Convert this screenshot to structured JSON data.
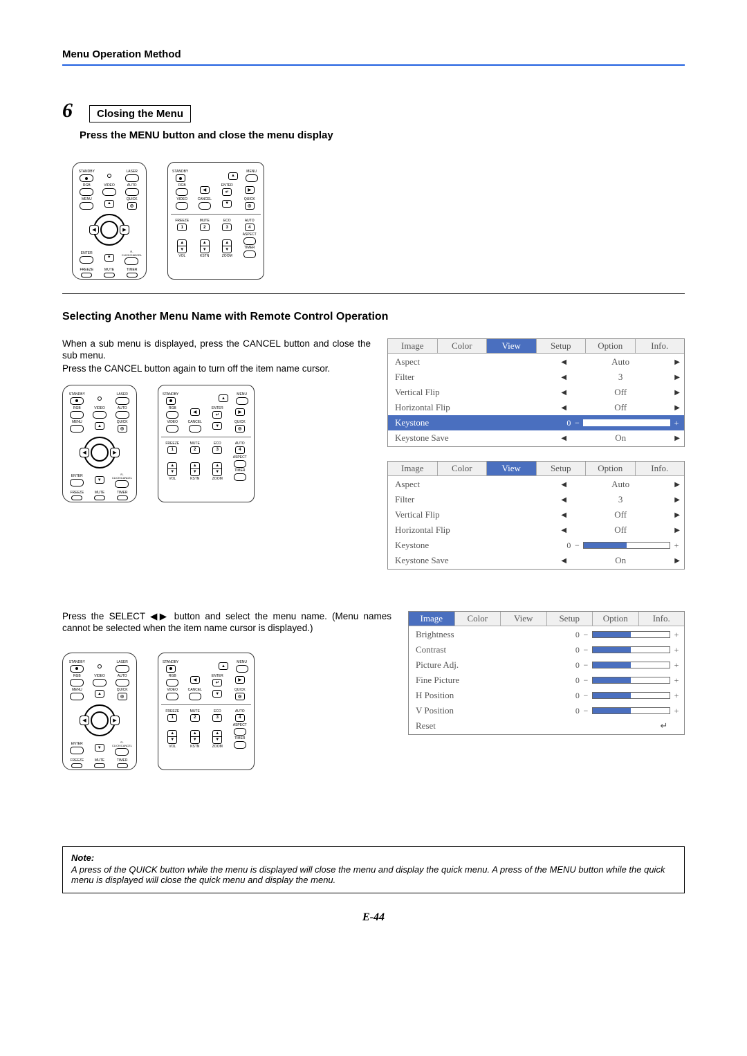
{
  "header": {
    "title": "Menu Operation Method"
  },
  "step6": {
    "number": "6",
    "box_title": "Closing the Menu",
    "instruction": "Press the MENU button and close the menu display"
  },
  "section2": {
    "heading": "Selecting Another Menu Name with Remote Control Operation",
    "para1a": "When a sub menu is displayed, press the CANCEL button and close the sub menu.",
    "para1b": "Press the CANCEL button again to turn off the item name cursor.",
    "para2": "Press the SELECT ◀▶ button and select the menu name. (Menu names cannot be selected when the item name cursor is displayed.)"
  },
  "remote_small": {
    "labels": [
      "STANDBY",
      "LASER",
      "RGB",
      "VIDEO",
      "AUTO",
      "MENU",
      "QUICK",
      "ENTER",
      "R-CLICK/CANCEL",
      "FREEZE",
      "MUTE",
      "TIMER"
    ]
  },
  "remote_card": {
    "labels_top": [
      "STANDBY",
      "MENU",
      "RGB",
      "ENTER",
      "VIDEO",
      "CANCEL",
      "QUICK"
    ],
    "labels_mid": [
      "FREEZE",
      "MUTE",
      "ECO",
      "AUTO",
      "ASPECT"
    ],
    "labels_bot": [
      "VOL",
      "KSTN",
      "ZOOM",
      "TIMER"
    ],
    "nums": [
      "1",
      "2",
      "3",
      "4"
    ]
  },
  "osd_tabs": [
    "Image",
    "Color",
    "View",
    "Setup",
    "Option",
    "Info."
  ],
  "osd_view": {
    "active_tab": "View",
    "items": [
      {
        "label": "Aspect",
        "type": "choice",
        "value": "Auto"
      },
      {
        "label": "Filter",
        "type": "choice",
        "value": "3"
      },
      {
        "label": "Vertical Flip",
        "type": "choice",
        "value": "Off"
      },
      {
        "label": "Horizontal Flip",
        "type": "choice",
        "value": "Off"
      },
      {
        "label": "Keystone",
        "type": "slider",
        "value": "0"
      },
      {
        "label": "Keystone Save",
        "type": "choice",
        "value": "On"
      }
    ],
    "highlight_a": "Keystone",
    "highlight_b": null
  },
  "osd_image": {
    "active_tab": "Image",
    "items": [
      {
        "label": "Brightness",
        "type": "slider",
        "value": "0"
      },
      {
        "label": "Contrast",
        "type": "slider",
        "value": "0"
      },
      {
        "label": "Picture Adj.",
        "type": "slider",
        "value": "0"
      },
      {
        "label": "Fine Picture",
        "type": "slider",
        "value": "0"
      },
      {
        "label": "H Position",
        "type": "slider",
        "value": "0"
      },
      {
        "label": "V Position",
        "type": "slider",
        "value": "0"
      },
      {
        "label": "Reset",
        "type": "enter",
        "value": "↵"
      }
    ]
  },
  "note": {
    "title": "Note:",
    "body": "A press of the QUICK button while the menu is displayed will close the menu and display the quick menu. A press of the MENU button while the quick menu is displayed will close the quick menu and display the menu."
  },
  "page_number": "E-44"
}
